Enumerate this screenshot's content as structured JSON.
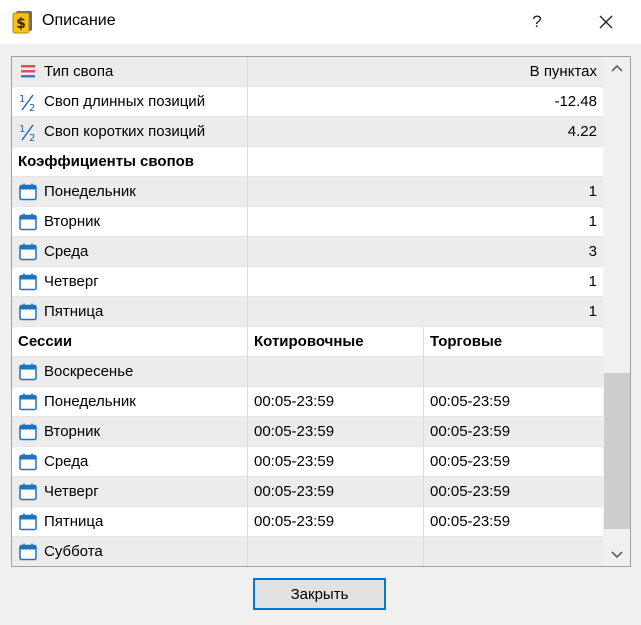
{
  "window": {
    "title": "Описание",
    "help_label": "?",
    "close_button_label": "Закрыть"
  },
  "swap": {
    "type_label": "Тип свопа",
    "type_value": "В пунктах",
    "long_label": "Своп длинных позиций",
    "long_value": "-12.48",
    "short_label": "Своп коротких позиций",
    "short_value": "4.22"
  },
  "coefficients": {
    "header": "Коэффициенты свопов",
    "days": [
      {
        "label": "Понедельник",
        "value": "1"
      },
      {
        "label": "Вторник",
        "value": "1"
      },
      {
        "label": "Среда",
        "value": "3"
      },
      {
        "label": "Четверг",
        "value": "1"
      },
      {
        "label": "Пятница",
        "value": "1"
      }
    ]
  },
  "sessions": {
    "header": "Сессии",
    "col_quotes": "Котировочные",
    "col_trade": "Торговые",
    "days": [
      {
        "label": "Воскресенье",
        "quotes": "",
        "trade": ""
      },
      {
        "label": "Понедельник",
        "quotes": "00:05-23:59",
        "trade": "00:05-23:59"
      },
      {
        "label": "Вторник",
        "quotes": "00:05-23:59",
        "trade": "00:05-23:59"
      },
      {
        "label": "Среда",
        "quotes": "00:05-23:59",
        "trade": "00:05-23:59"
      },
      {
        "label": "Четверг",
        "quotes": "00:05-23:59",
        "trade": "00:05-23:59"
      },
      {
        "label": "Пятница",
        "quotes": "00:05-23:59",
        "trade": "00:05-23:59"
      },
      {
        "label": "Суббота",
        "quotes": "",
        "trade": ""
      }
    ]
  },
  "colors": {
    "accent": "#0078d7",
    "calendar_icon": "#1e73be",
    "row_grey": "#ececec"
  },
  "icons": {
    "app": "dollar-document-icon",
    "swap_type": "swap-type-icon",
    "fraction": "one-half-icon",
    "calendar": "calendar-icon"
  }
}
